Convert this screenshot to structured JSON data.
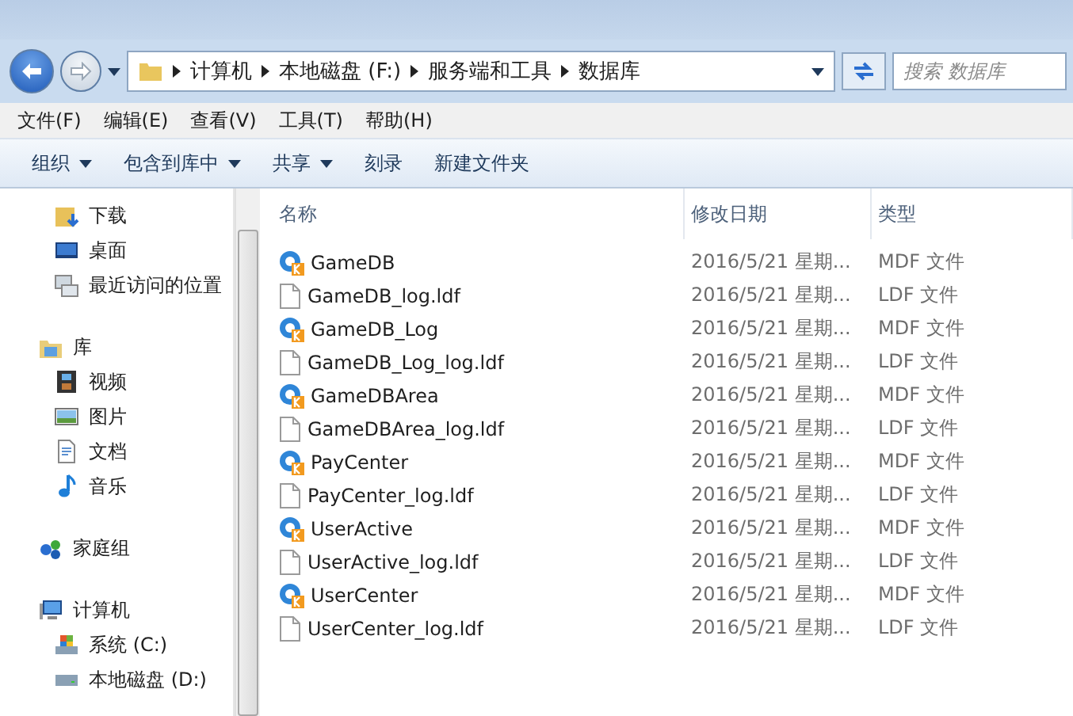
{
  "address": {
    "crumbs": [
      "计算机",
      "本地磁盘 (F:)",
      "服务端和工具",
      "数据库"
    ],
    "search": {
      "placeholder": "搜索 数据库"
    }
  },
  "menu": [
    "文件(F)",
    "编辑(E)",
    "查看(V)",
    "工具(T)",
    "帮助(H)"
  ],
  "toolbar": [
    {
      "label": "组织",
      "dropdown": true
    },
    {
      "label": "包含到库中",
      "dropdown": true
    },
    {
      "label": "共享",
      "dropdown": true
    },
    {
      "label": "刻录",
      "dropdown": false
    },
    {
      "label": "新建文件夹",
      "dropdown": false
    }
  ],
  "sidebar": [
    {
      "children": [
        {
          "label": "下载",
          "kind": "download"
        },
        {
          "label": "桌面",
          "kind": "desktop"
        },
        {
          "label": "最近访问的位置",
          "kind": "recent"
        }
      ]
    },
    {
      "label": "库",
      "kind": "library",
      "children": [
        {
          "label": "视频",
          "kind": "video"
        },
        {
          "label": "图片",
          "kind": "picture"
        },
        {
          "label": "文档",
          "kind": "document"
        },
        {
          "label": "音乐",
          "kind": "music"
        }
      ]
    },
    {
      "label": "家庭组",
      "kind": "homegroup"
    },
    {
      "label": "计算机",
      "kind": "computer",
      "children": [
        {
          "label": "系统 (C:)",
          "kind": "drive"
        },
        {
          "label": "本地磁盘 (D:)",
          "kind": "disk"
        }
      ]
    }
  ],
  "table": {
    "columns": [
      "名称",
      "修改日期",
      "类型"
    ],
    "rows": [
      {
        "name": "GameDB",
        "date": "2016/5/21 星期...",
        "type": "MDF 文件",
        "kind": "mdf"
      },
      {
        "name": "GameDB_log.ldf",
        "date": "2016/5/21 星期...",
        "type": "LDF 文件",
        "kind": "file"
      },
      {
        "name": "GameDB_Log",
        "date": "2016/5/21 星期...",
        "type": "MDF 文件",
        "kind": "mdf"
      },
      {
        "name": "GameDB_Log_log.ldf",
        "date": "2016/5/21 星期...",
        "type": "LDF 文件",
        "kind": "file"
      },
      {
        "name": "GameDBArea",
        "date": "2016/5/21 星期...",
        "type": "MDF 文件",
        "kind": "mdf"
      },
      {
        "name": "GameDBArea_log.ldf",
        "date": "2016/5/21 星期...",
        "type": "LDF 文件",
        "kind": "file"
      },
      {
        "name": "PayCenter",
        "date": "2016/5/21 星期...",
        "type": "MDF 文件",
        "kind": "mdf"
      },
      {
        "name": "PayCenter_log.ldf",
        "date": "2016/5/21 星期...",
        "type": "LDF 文件",
        "kind": "file"
      },
      {
        "name": "UserActive",
        "date": "2016/5/21 星期...",
        "type": "MDF 文件",
        "kind": "mdf"
      },
      {
        "name": "UserActive_log.ldf",
        "date": "2016/5/21 星期...",
        "type": "LDF 文件",
        "kind": "file"
      },
      {
        "name": "UserCenter",
        "date": "2016/5/21 星期...",
        "type": "MDF 文件",
        "kind": "mdf"
      },
      {
        "name": "UserCenter_log.ldf",
        "date": "2016/5/21 星期...",
        "type": "LDF 文件",
        "kind": "file"
      }
    ]
  }
}
